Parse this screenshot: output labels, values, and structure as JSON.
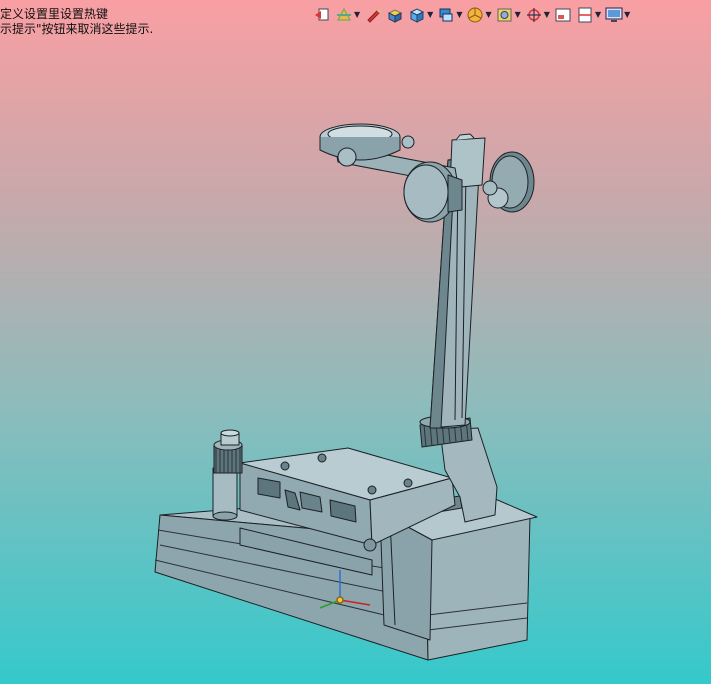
{
  "viewport": {
    "hint_line1": "定义设置里设置热键",
    "hint_line2": "示提示\"按钮来取消这些提示."
  },
  "toolbar": {
    "buttons": [
      {
        "name": "previous-view-icon",
        "dropdown": false
      },
      {
        "name": "section-view-icon",
        "dropdown": true
      },
      {
        "name": "dynamic-annotation-icon",
        "dropdown": false
      },
      {
        "name": "draw-mode-icon",
        "dropdown": false
      },
      {
        "name": "view-orientation-icon",
        "dropdown": true
      },
      {
        "name": "display-style-icon",
        "dropdown": true
      },
      {
        "name": "hide-show-items-icon",
        "dropdown": true
      },
      {
        "name": "edit-appearance-icon",
        "dropdown": true
      },
      {
        "name": "apply-scene-icon",
        "dropdown": true
      },
      {
        "name": "view-setting-icon",
        "dropdown": false
      },
      {
        "name": "rotate-view-icon",
        "dropdown": true
      },
      {
        "name": "monitor-icon",
        "dropdown": true
      }
    ]
  },
  "colors": {
    "background_top": "#f99fa3",
    "background_bottom": "#35c9cb",
    "model_fill": "#8fa9b0",
    "model_edge": "#1b2126"
  }
}
